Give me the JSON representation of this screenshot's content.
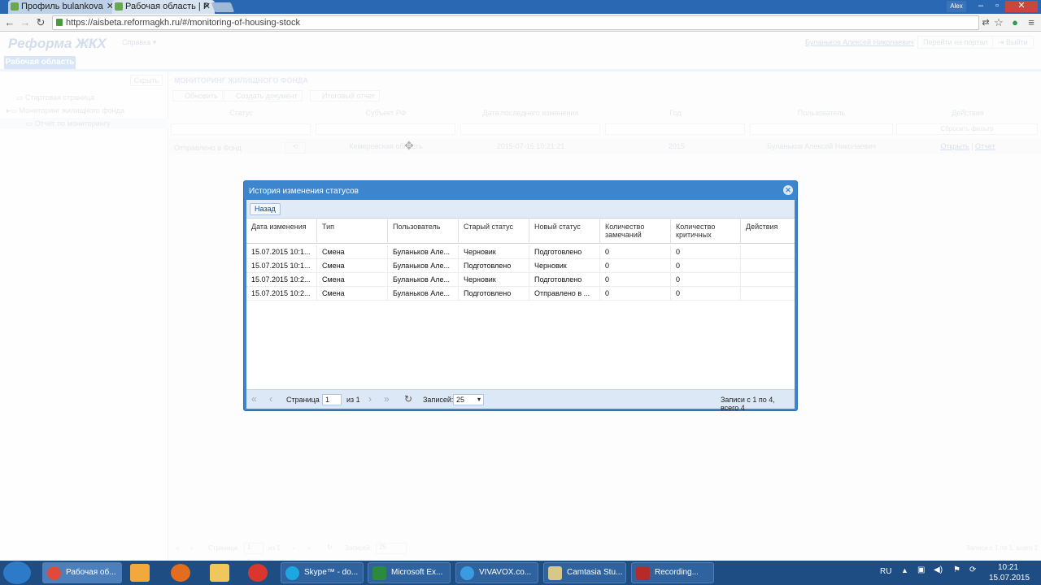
{
  "browser": {
    "tabs": [
      {
        "label": "Профиль bulankova"
      },
      {
        "label": "Рабочая область | Р"
      }
    ],
    "profile": "Alex",
    "url": "https://aisbeta.reformagkh.ru/#/monitoring-of-housing-stock"
  },
  "app": {
    "logo": "Реформа ЖКХ",
    "help_menu": "Справка",
    "user_name": "Буланьков Алексей Николаевич",
    "portal_button": "Перейти на портал",
    "exit_button": "Выйти",
    "work_tab": "Рабочая область",
    "hide_button": "Скрыть",
    "tree": {
      "start": "Стартовая страница",
      "monitoring": "Мониторинг жилищного фонда",
      "report": "Отчет по мониторингу"
    },
    "section_title": "МОНИТОРИНГ ЖИЛИЩНОГО ФОНДА",
    "toolbar": {
      "refresh": "Обновить",
      "create": "Создать документ",
      "final_report": "Итоговый отчет"
    },
    "columns": {
      "status": "Статус",
      "subject": "Субъект РФ",
      "date": "Дата последнего изменения",
      "year": "Год",
      "user": "Пользователь",
      "actions": "Действия"
    },
    "reset_filter": "Сбросить фильтр",
    "row": {
      "status": "Отправлено в Фонд",
      "subject": "Кемеровская область",
      "date": "2015-07-15 10:21:21",
      "year": "2015",
      "user": "Буланьков Алексей Николаевич",
      "open": "Открыть",
      "sep": "|",
      "report": "Отчет"
    },
    "paging": {
      "page_label": "Страница",
      "page": "1",
      "of": "из 1",
      "records_label": "Записей:",
      "records": "25",
      "summary": "Записи с 1 по 1, всего 1"
    }
  },
  "modal": {
    "title": "История изменения статусов",
    "back_button": "Назад",
    "headers": [
      "Дата изменения",
      "Тип",
      "Пользователь",
      "Старый статус",
      "Новый статус",
      "Количество замечаний",
      "Количество критичных",
      "Действия"
    ],
    "rows": [
      [
        "15.07.2015 10:1...",
        "Смена",
        "Буланьков Але...",
        "Черновик",
        "Подготовлено",
        "0",
        "0",
        ""
      ],
      [
        "15.07.2015 10:1...",
        "Смена",
        "Буланьков Але...",
        "Подготовлено",
        "Черновик",
        "0",
        "0",
        ""
      ],
      [
        "15.07.2015 10:2...",
        "Смена",
        "Буланьков Але...",
        "Черновик",
        "Подготовлено",
        "0",
        "0",
        ""
      ],
      [
        "15.07.2015 10:2...",
        "Смена",
        "Буланьков Але...",
        "Подготовлено",
        "Отправлено в ...",
        "0",
        "0",
        ""
      ]
    ],
    "paging": {
      "page_label": "Страница",
      "page": "1",
      "of": "из 1",
      "records_label": "Записей:",
      "records": "25",
      "summary": "Записи с 1 по 4, всего 4"
    }
  },
  "taskbar": {
    "items": [
      {
        "label": "Рабочая об..."
      },
      {
        "label": "Skype™ - do..."
      },
      {
        "label": "Microsoft Ex..."
      },
      {
        "label": "VIVAVOX.co..."
      },
      {
        "label": "Camtasia Stu..."
      },
      {
        "label": "Recording..."
      }
    ],
    "lang": "RU",
    "time": "10:21",
    "date": "15.07.2015"
  },
  "colors": {
    "accent": "#3d85cc",
    "taskbar": "#1e4d84"
  }
}
